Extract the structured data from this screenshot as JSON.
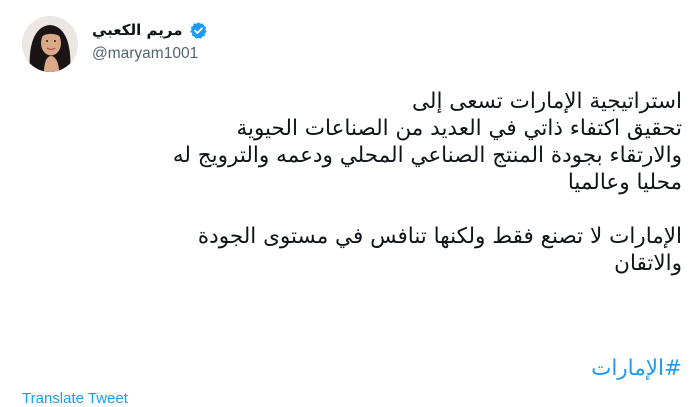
{
  "author": {
    "display_name": "مريم الكعبي",
    "handle": "@maryam1001",
    "verified": true,
    "verified_color": "#1d9bf0"
  },
  "tweet": {
    "lines": [
      "استراتيجية الإمارات تسعى إلى",
      "تحقيق اكتفاء ذاتي في العديد من الصناعات الحيوية",
      "والارتقاء بجودة المنتج الصناعي المحلي ودعمه والترويج له",
      "محليا وعالميا",
      "",
      "الإمارات لا تصنع فقط ولكنها تنافس في مستوى الجودة",
      "والاتقان"
    ],
    "hashtag": "#الإمارات"
  },
  "actions": {
    "translate_label": "Translate Tweet"
  },
  "colors": {
    "text": "#0f1419",
    "secondary": "#536471",
    "link": "#1d9bf0"
  }
}
